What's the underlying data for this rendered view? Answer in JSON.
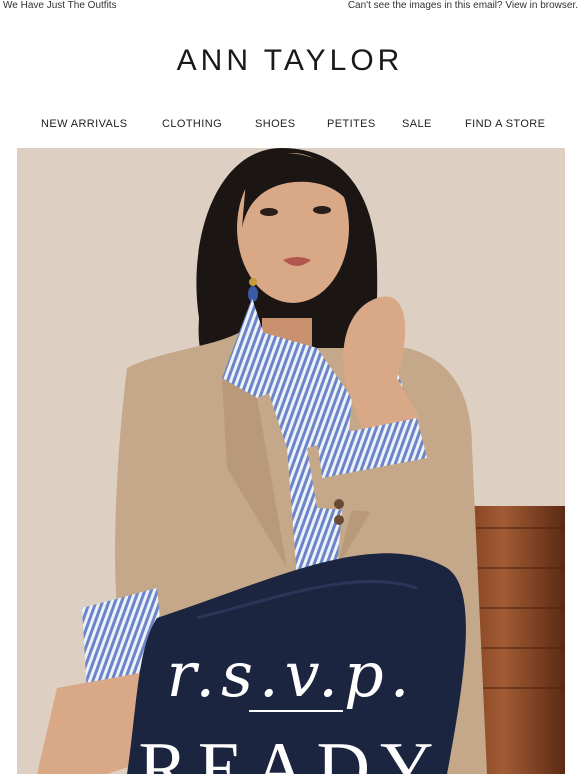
{
  "preheader": {
    "left_text": "We Have Just The Outfits",
    "right_text": "Can't see the images in this email? View in browser."
  },
  "brand": {
    "logo_text": "ANN TAYLOR"
  },
  "nav": {
    "items": [
      {
        "label": "NEW ARRIVALS"
      },
      {
        "label": "CLOTHING"
      },
      {
        "label": "SHOES"
      },
      {
        "label": "PETITES"
      },
      {
        "label": "SALE"
      },
      {
        "label": "FIND A STORE"
      }
    ]
  },
  "hero": {
    "script_text": "r.s.v.p.",
    "headline_text": "READY",
    "colors": {
      "background": "#ddd0c3",
      "blazer": "#c4a889",
      "jeans": "#1c2540",
      "chair": "#8a4a2a",
      "skin": "#d9a886",
      "hair": "#1b1614",
      "shirt_stripe": "#6a86c9"
    }
  }
}
